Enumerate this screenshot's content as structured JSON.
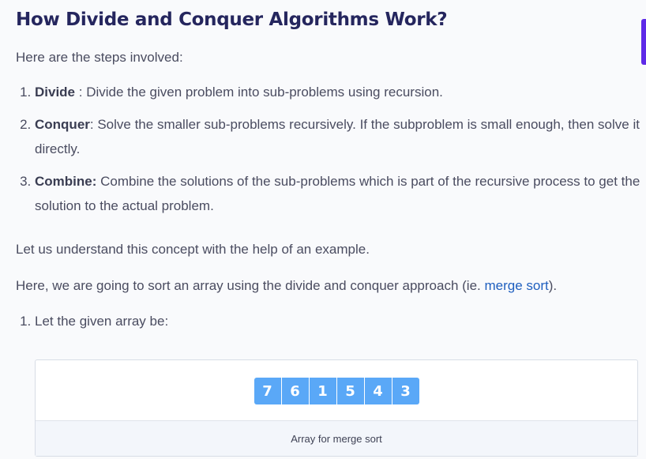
{
  "title": "How Divide and Conquer Algorithms Work?",
  "intro": "Here are the steps involved:",
  "steps": [
    {
      "term": "Divide",
      "text": " : Divide the given problem into sub-problems using recursion."
    },
    {
      "term": "Conquer",
      "text": ": Solve the smaller sub-problems recursively. If the subproblem is small enough, then solve it directly."
    },
    {
      "term": "Combine:",
      "text": " Combine the solutions of the sub-problems which is part of the recursive process to get the solution to the actual problem."
    }
  ],
  "understand": "Let us understand this concept with the help of an example.",
  "here": {
    "before": "Here, we are going to sort an array using the divide and conquer approach (ie. ",
    "link": "merge sort",
    "after": ")."
  },
  "example_steps": [
    "Let the given array be:"
  ],
  "figure": {
    "array": [
      "7",
      "6",
      "1",
      "5",
      "4",
      "3"
    ],
    "caption": "Array for merge sort"
  },
  "colors": {
    "heading": "#25265e",
    "link": "#1f5fbf",
    "array_cell": "#5aa8f7",
    "edge_accent": "#5e2ae8"
  }
}
